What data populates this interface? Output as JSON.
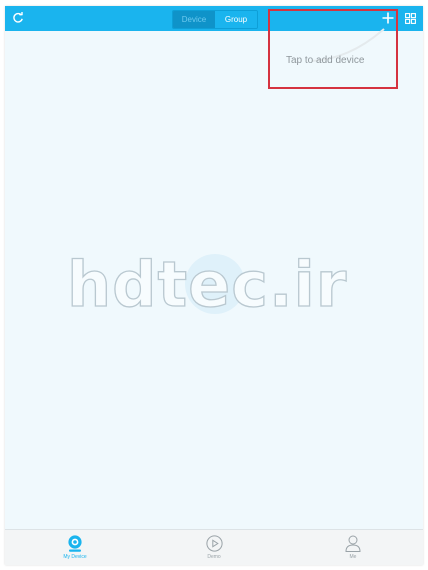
{
  "header": {
    "refresh_icon": "refresh-icon",
    "tabs": [
      {
        "label": "Device",
        "active": true
      },
      {
        "label": "Group",
        "active": false
      }
    ],
    "add_icon": "plus-icon",
    "grid_icon": "grid-icon"
  },
  "tip": {
    "text": "Tap to add device",
    "highlight_color": "#d53340"
  },
  "watermark": "hdtec.ir",
  "tabbar": {
    "items": [
      {
        "label": "My Device",
        "icon": "camera-icon",
        "active": true
      },
      {
        "label": "Demo",
        "icon": "play-icon",
        "active": false
      },
      {
        "label": "Me",
        "icon": "person-icon",
        "active": false
      }
    ]
  },
  "colors": {
    "accent": "#1ab4ee",
    "background": "#f0f9fd"
  }
}
